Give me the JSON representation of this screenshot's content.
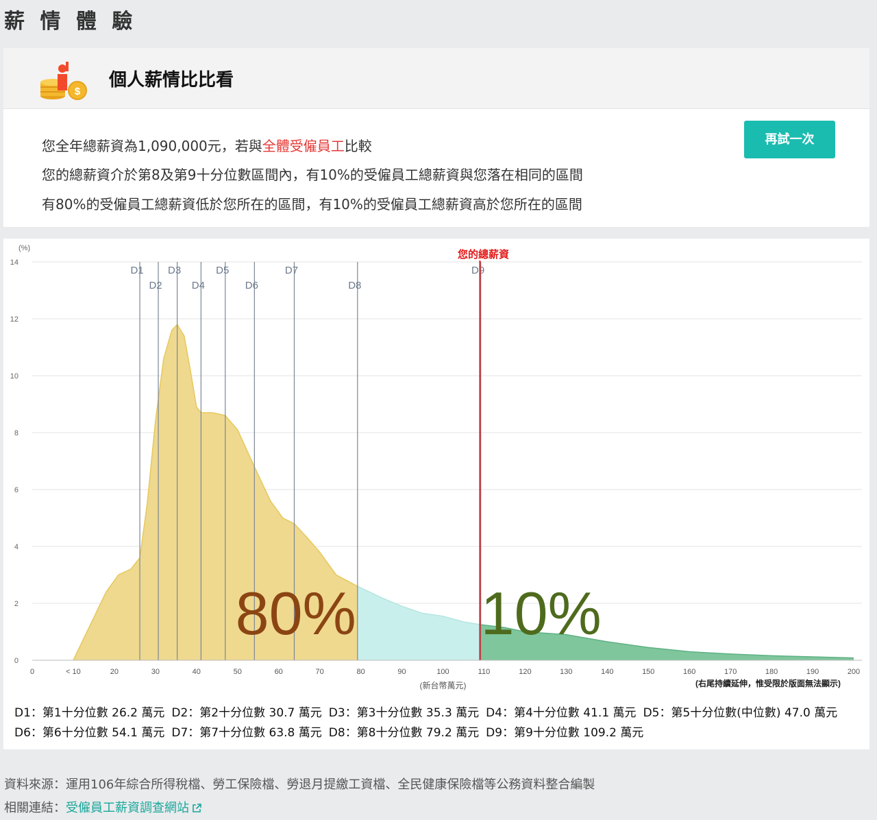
{
  "page": {
    "title": "薪 情 體 驗"
  },
  "header_card": {
    "title": "個人薪情比比看",
    "icon": "coins-worker-icon"
  },
  "summary": {
    "line1_prefix": "您全年總薪資為1,090,000元，若與",
    "line1_highlight": "全體受僱員工",
    "line1_suffix": "比較",
    "line2": "您的總薪資介於第8及第9十分位數區間內，有10%的受僱員工總薪資與您落在相同的區間",
    "line3": "有80%的受僱員工總薪資低於您所在的區間，有10%的受僱員工總薪資高於您所在的區間",
    "retry_button": "再試一次"
  },
  "chart_data": {
    "type": "area",
    "y_unit_label": "(%)",
    "x_unit_label": "(新台幣萬元)",
    "x_note": "(右尾持續延伸，惟受限於版面無法顯示)",
    "ylim": [
      0,
      14
    ],
    "xlim": [
      0,
      200
    ],
    "y_ticks": [
      0,
      2,
      4,
      6,
      8,
      10,
      12,
      14
    ],
    "x_ticks": [
      {
        "v": 0,
        "label": "0"
      },
      {
        "v": 10,
        "label": "< 10"
      },
      {
        "v": 20,
        "label": "20"
      },
      {
        "v": 30,
        "label": "30"
      },
      {
        "v": 40,
        "label": "40"
      },
      {
        "v": 50,
        "label": "50"
      },
      {
        "v": 60,
        "label": "60"
      },
      {
        "v": 70,
        "label": "70"
      },
      {
        "v": 80,
        "label": "80"
      },
      {
        "v": 90,
        "label": "90"
      },
      {
        "v": 100,
        "label": "100"
      },
      {
        "v": 110,
        "label": "110"
      },
      {
        "v": 120,
        "label": "120"
      },
      {
        "v": 130,
        "label": "130"
      },
      {
        "v": 140,
        "label": "140"
      },
      {
        "v": 150,
        "label": "150"
      },
      {
        "v": 160,
        "label": "160"
      },
      {
        "v": 170,
        "label": "170"
      },
      {
        "v": 180,
        "label": "180"
      },
      {
        "v": 190,
        "label": "190"
      },
      {
        "v": 200,
        "label": "200"
      }
    ],
    "distribution": [
      [
        10,
        0
      ],
      [
        14,
        1.2
      ],
      [
        18,
        2.4
      ],
      [
        21,
        3.0
      ],
      [
        24,
        3.2
      ],
      [
        26.2,
        3.6
      ],
      [
        28,
        5.5
      ],
      [
        30,
        8.4
      ],
      [
        32,
        10.6
      ],
      [
        34,
        11.6
      ],
      [
        35.3,
        11.8
      ],
      [
        37,
        11.4
      ],
      [
        38.5,
        10.2
      ],
      [
        40,
        8.9
      ],
      [
        41.1,
        8.7
      ],
      [
        44,
        8.7
      ],
      [
        47,
        8.6
      ],
      [
        50,
        8.1
      ],
      [
        54.1,
        6.8
      ],
      [
        58,
        5.6
      ],
      [
        61,
        5.0
      ],
      [
        63.8,
        4.8
      ],
      [
        67,
        4.3
      ],
      [
        70,
        3.8
      ],
      [
        74,
        3.0
      ],
      [
        79.2,
        2.6
      ],
      [
        85,
        2.2
      ],
      [
        90,
        1.9
      ],
      [
        95,
        1.65
      ],
      [
        100,
        1.55
      ],
      [
        105,
        1.35
      ],
      [
        109.2,
        1.25
      ],
      [
        115,
        1.15
      ],
      [
        120,
        1.0
      ],
      [
        130,
        0.9
      ],
      [
        140,
        0.65
      ],
      [
        150,
        0.45
      ],
      [
        160,
        0.3
      ],
      [
        170,
        0.22
      ],
      [
        180,
        0.16
      ],
      [
        190,
        0.12
      ],
      [
        200,
        0.08
      ]
    ],
    "deciles": [
      {
        "label": "D1",
        "x": 26.2,
        "row": 1
      },
      {
        "label": "D2",
        "x": 30.7,
        "row": 2
      },
      {
        "label": "D3",
        "x": 35.3,
        "row": 1
      },
      {
        "label": "D4",
        "x": 41.1,
        "row": 2
      },
      {
        "label": "D5",
        "x": 47.0,
        "row": 1
      },
      {
        "label": "D6",
        "x": 54.1,
        "row": 2
      },
      {
        "label": "D7",
        "x": 63.8,
        "row": 1
      },
      {
        "label": "D8",
        "x": 79.2,
        "row": 2
      },
      {
        "label": "D9",
        "x": 109.2,
        "row": 1
      }
    ],
    "user_line": {
      "x": 109,
      "label": "您的總薪資"
    },
    "regions": [
      {
        "from": 0,
        "to": 79.2,
        "color": "#efd98f",
        "stroke": "#e6c85c"
      },
      {
        "from": 79.2,
        "to": 109.2,
        "color": "#c9efec",
        "stroke": "#b3e6e1"
      },
      {
        "from": 109.2,
        "to": 200,
        "color": "#7fc69c",
        "stroke": "#5fb184"
      }
    ],
    "big_labels": [
      {
        "text": "80%",
        "color": "#8b4513"
      },
      {
        "text": "10%",
        "color": "#4e6b1d"
      }
    ]
  },
  "legend": {
    "row1": [
      "D1：第1十分位數 26.2 萬元",
      "D2：第2十分位數 30.7 萬元",
      "D3：第3十分位數 35.3 萬元",
      "D4：第4十分位數 41.1 萬元",
      "D5：第5十分位數(中位數) 47.0 萬元"
    ],
    "row2": [
      "D6：第6十分位數 54.1 萬元",
      "D7：第7十分位數 63.8 萬元",
      "D8：第8十分位數 79.2 萬元",
      "D9：第9十分位數 109.2 萬元"
    ]
  },
  "footer": {
    "source": "資料來源：運用106年綜合所得稅檔、勞工保險檔、勞退月提繳工資檔、全民健康保險檔等公務資料整合編製",
    "link_prefix": "相關連結：",
    "link_text": "受僱員工薪資調查網站"
  }
}
